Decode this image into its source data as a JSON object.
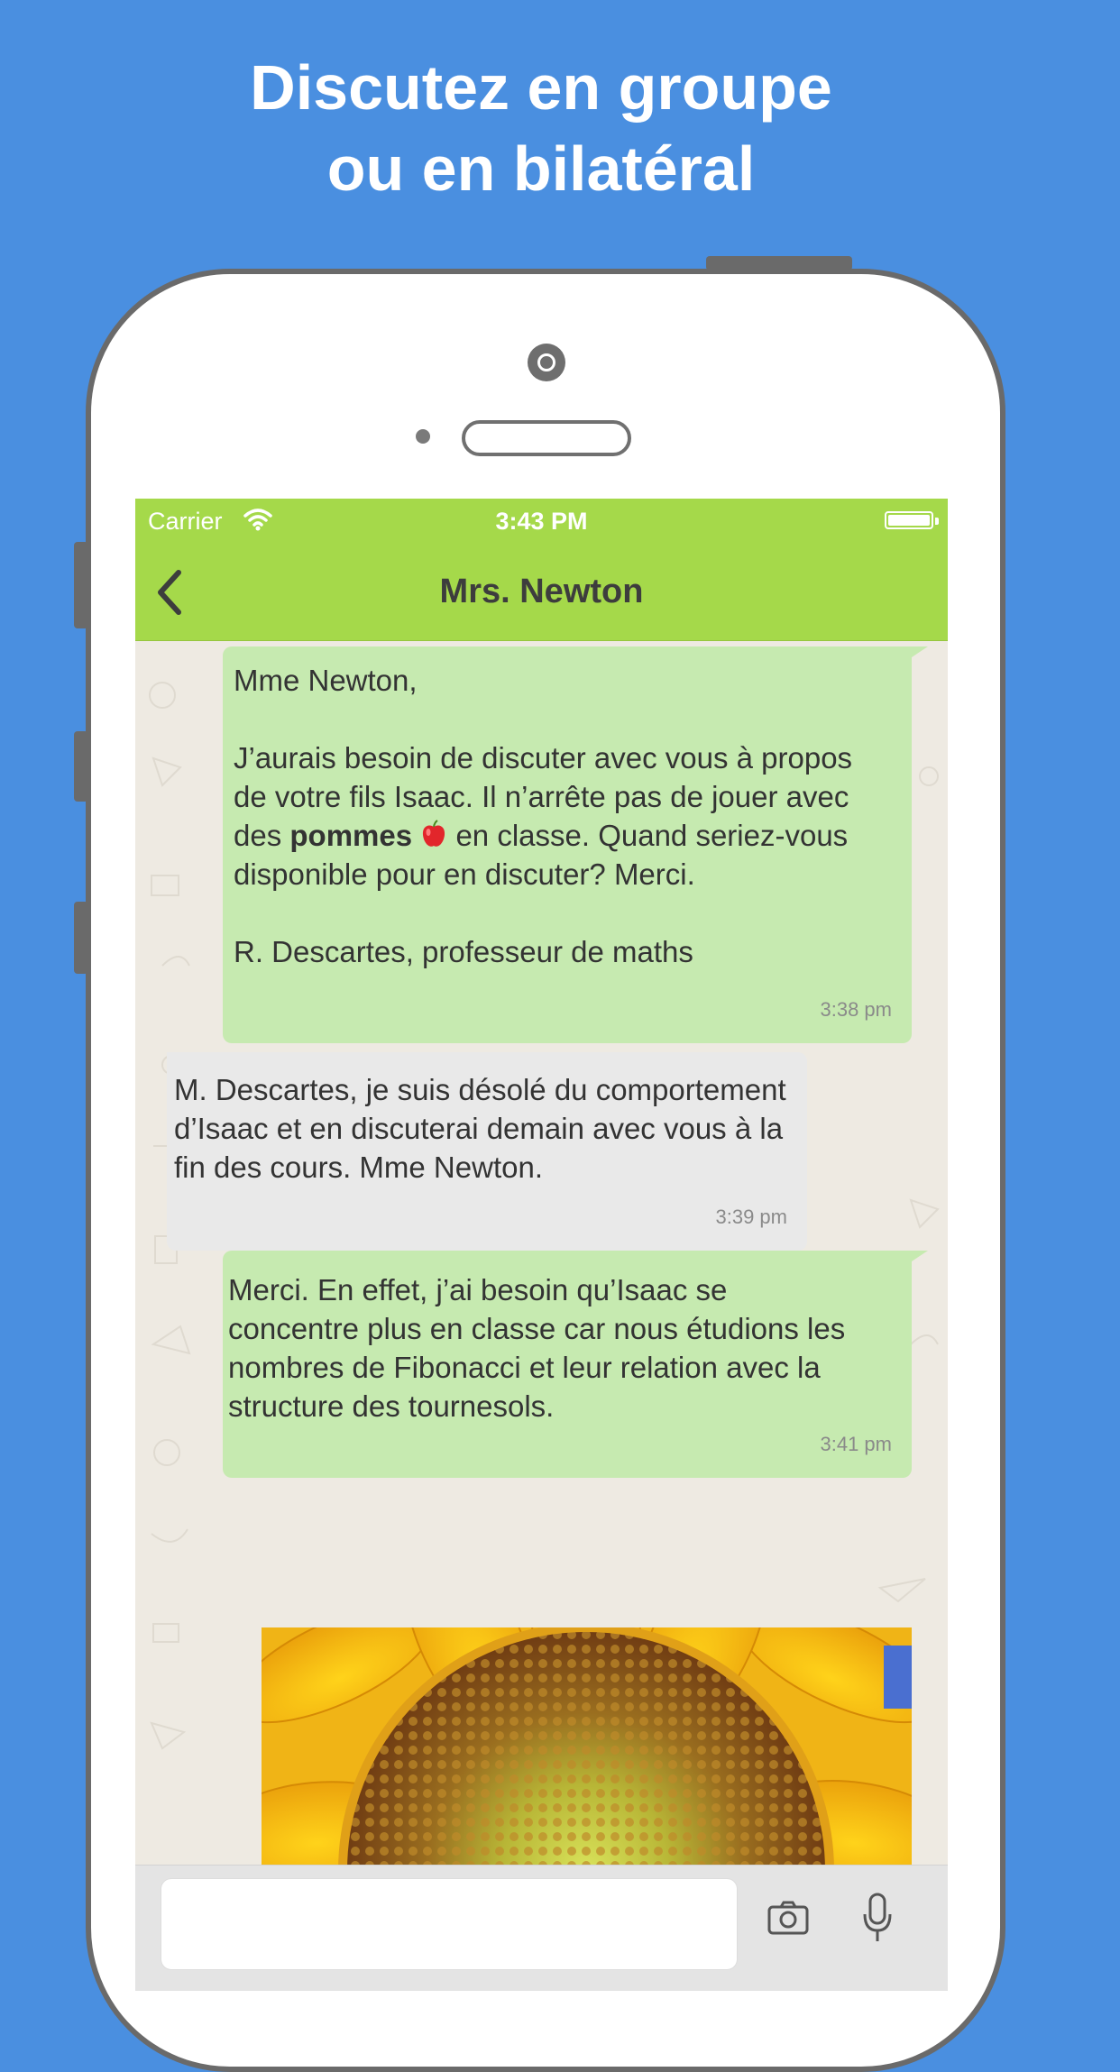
{
  "banner": {
    "line1": "Discutez en groupe",
    "line2": "ou en bilatéral"
  },
  "status_bar": {
    "carrier": "Carrier",
    "time": "3:43 PM"
  },
  "nav": {
    "title": "Mrs. Newton"
  },
  "messages": [
    {
      "direction": "outgoing",
      "lines": [
        "Mme Newton,",
        "",
        "J’aurais besoin de discuter avec vous à propos",
        "de votre fils Isaac. Il n’arrête pas de jouer avec",
        "des",
        "pommes",
        "en classe. Quand seriez-vous",
        "disponible pour en discuter? Merci.",
        "",
        "R. Descartes, professeur de maths"
      ],
      "time": "3:38 pm"
    },
    {
      "direction": "incoming",
      "lines": [
        "M. Descartes, je suis désolé du comportement",
        "d’Isaac et en discuterai demain avec vous à la",
        "fin des cours. Mme Newton."
      ],
      "time": "3:39 pm"
    },
    {
      "direction": "outgoing",
      "lines": [
        "Merci. En effet, j’ai besoin qu’Isaac se",
        "concentre plus en classe car nous étudions les",
        "nombres de Fibonacci et leur relation avec la",
        "structure des tournesols."
      ],
      "time": "3:41 pm"
    }
  ],
  "attachment": {
    "kind": "image",
    "subject": "sunflower-photo"
  },
  "icons": {
    "back": "chevron-left-icon",
    "wifi": "wifi-icon",
    "battery": "battery-icon",
    "apple": "apple-icon",
    "camera": "camera-icon",
    "mic": "microphone-icon"
  },
  "colors": {
    "background": "#4a8fe0",
    "header": "#a5d94a",
    "outgoing_bubble": "#c6eab0",
    "incoming_bubble": "#e9e9e9"
  }
}
